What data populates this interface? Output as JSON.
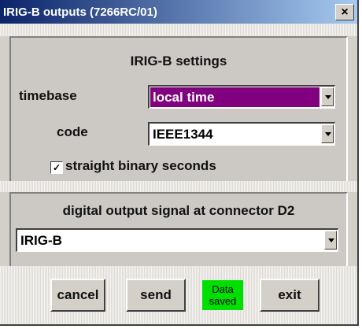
{
  "window": {
    "title": "IRIG-B outputs (7266RC/01)",
    "close_label": "×"
  },
  "settings": {
    "heading": "IRIG-B settings",
    "timebase": {
      "label": "timebase",
      "value": "local time",
      "highlight_color": "#800080"
    },
    "code": {
      "label": "code",
      "value": "IEEE1344"
    },
    "straight_binary": {
      "label": "straight binary seconds",
      "checked": true,
      "mark": "☑"
    }
  },
  "output": {
    "heading": "digital output signal at connector D2",
    "value": "IRIG-B"
  },
  "buttons": {
    "cancel": "cancel",
    "send": "send",
    "exit": "exit"
  },
  "status": {
    "line1": "Data",
    "line2": "saved",
    "color": "#00e000"
  }
}
